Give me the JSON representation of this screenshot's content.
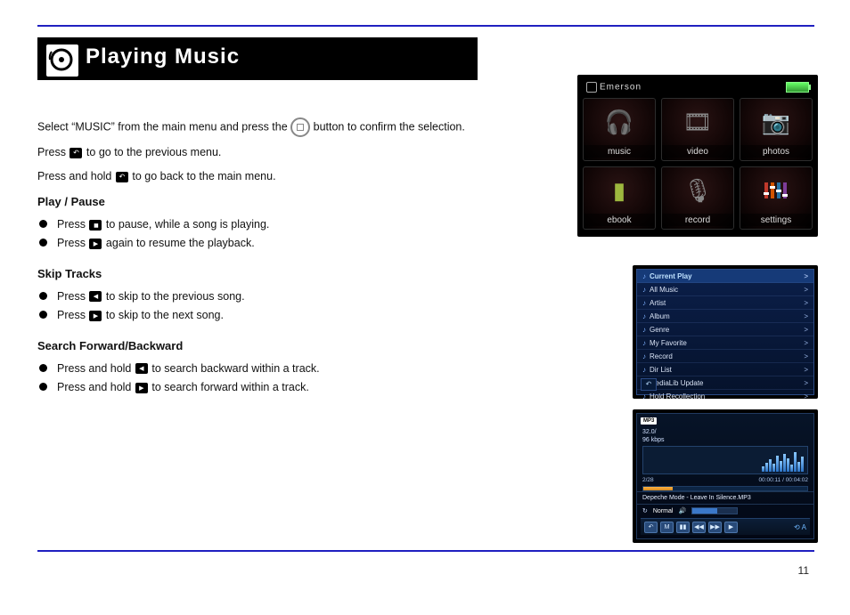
{
  "page_number": "11",
  "title_bar": {
    "label": "Playing Music"
  },
  "intro": {
    "p1_a": "Select “MUSIC” from the main menu and press the ",
    "p1_b": " button to confirm the selection.",
    "p2_a": "Press ",
    "p2_b": " to go to the previous menu.",
    "p3_a": "Press and hold ",
    "p3_b": " to go back to the main menu."
  },
  "play_pause": {
    "heading": "Play / Pause",
    "li1_a": "Press ",
    "li1_b": " to pause, while a song is playing.",
    "li2_a": "Press ",
    "li2_b": " again to resume the playback."
  },
  "skip": {
    "heading": "Skip Tracks",
    "li1_a": "Press ",
    "li1_b": " to skip to the previous song.",
    "li2_a": "Press ",
    "li2_b": " to skip to the next song."
  },
  "search": {
    "heading": "Search Forward/Backward",
    "li1_a": "Press and hold ",
    "li1_b": " to search backward within a track.",
    "li2_a": "Press and hold ",
    "li2_b": " to search forward within a track."
  },
  "device": {
    "brand": "Emerson",
    "tiles": [
      "music",
      "video",
      "photos",
      "ebook",
      "record",
      "settings"
    ]
  },
  "music_list": {
    "items": [
      "Current Play",
      "All Music",
      "Artist",
      "Album",
      "Genre",
      "My Favorite",
      "Record",
      "Dir List",
      "MediaLib Update",
      "Hold Recollection"
    ],
    "selected_index": 0
  },
  "now_playing": {
    "codec_badge": "MP3",
    "bitrate_line1": "32.0/",
    "bitrate_line2": "96 kbps",
    "counter": "2/28",
    "time_elapsed": "00:00:11",
    "time_total": "00:04:02",
    "track": "Depeche Mode - Leave In Silence.MP3",
    "repeat_icon_label": "↻",
    "eq_label": "Normal",
    "volume_icon_label": "🔊",
    "loop_label": "A",
    "controls": [
      "↶",
      "M",
      "▮▮",
      "◀◀",
      "▶▶",
      "▶"
    ]
  }
}
